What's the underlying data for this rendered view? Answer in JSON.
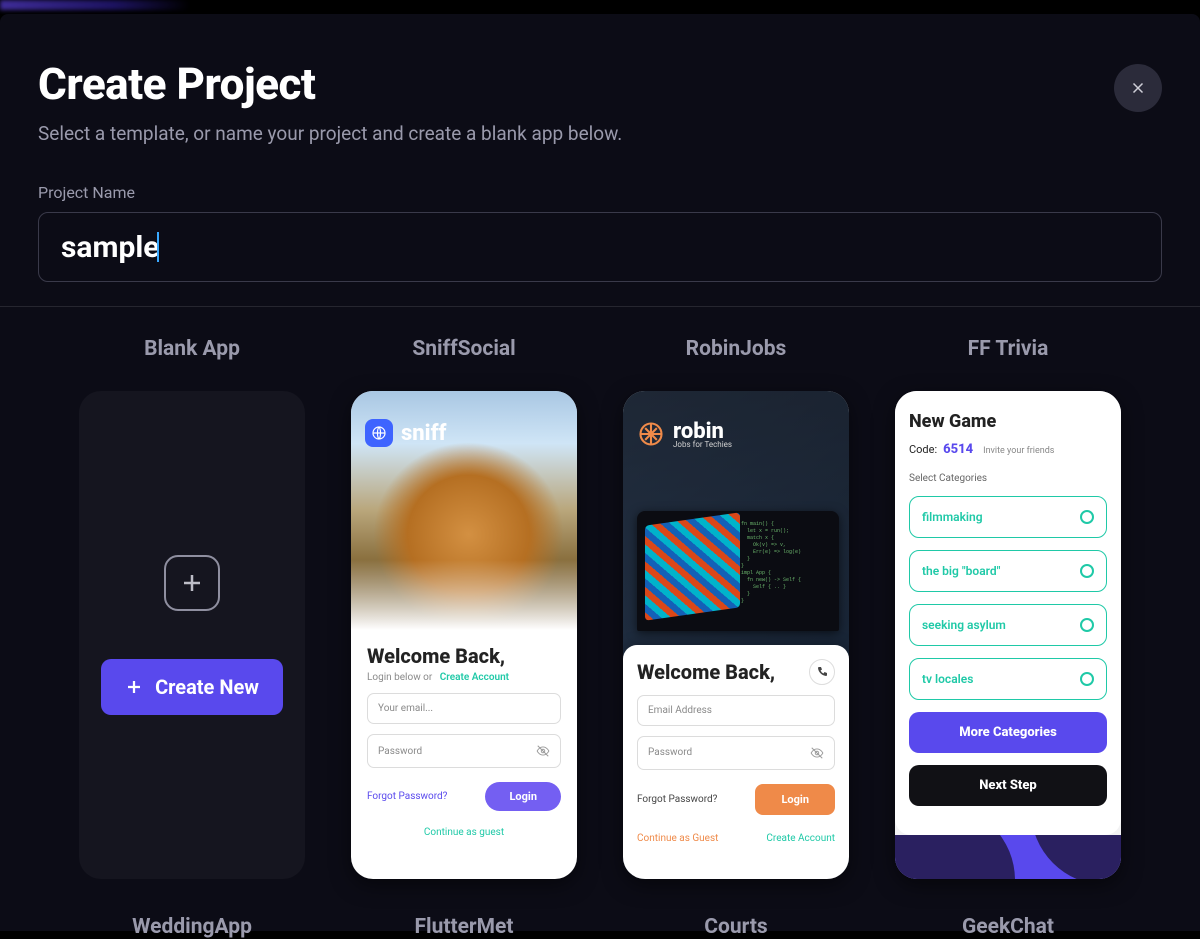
{
  "header": {
    "title": "Create Project",
    "subtitle": "Select a template, or name your project and create a blank app below.",
    "name_label": "Project Name",
    "name_value": "sample"
  },
  "blank": {
    "title": "Blank App",
    "create_button": "Create New"
  },
  "templates_row1": {
    "sniff": {
      "title": "SniffSocial",
      "logo_text": "sniff",
      "welcome": "Welcome Back,",
      "login_sub_prefix": "Login below or",
      "create_account": "Create Account",
      "email_placeholder": "Your email...",
      "password_placeholder": "Password",
      "forgot": "Forgot Password?",
      "login_btn": "Login",
      "guest": "Continue as guest"
    },
    "robin": {
      "title": "RobinJobs",
      "logo_text": "robin",
      "logo_sub": "Jobs for Techies",
      "welcome": "Welcome Back,",
      "email_placeholder": "Email Address",
      "password_placeholder": "Password",
      "forgot": "Forgot Password?",
      "login_btn": "Login",
      "guest": "Continue as Guest",
      "create_account": "Create Account"
    },
    "trivia": {
      "title": "FF Trivia",
      "heading": "New Game",
      "code_label": "Code:",
      "code_value": "6514",
      "invite": "Invite your friends",
      "select_label": "Select Categories",
      "categories": [
        "filmmaking",
        "the big \"board\"",
        "seeking asylum",
        "tv locales"
      ],
      "more_btn": "More Categories",
      "next_btn": "Next Step"
    }
  },
  "templates_row2": {
    "wedding": "WeddingApp",
    "fluttermet": "FlutterMet",
    "courts": "Courts",
    "geekchat": "GeekChat"
  }
}
